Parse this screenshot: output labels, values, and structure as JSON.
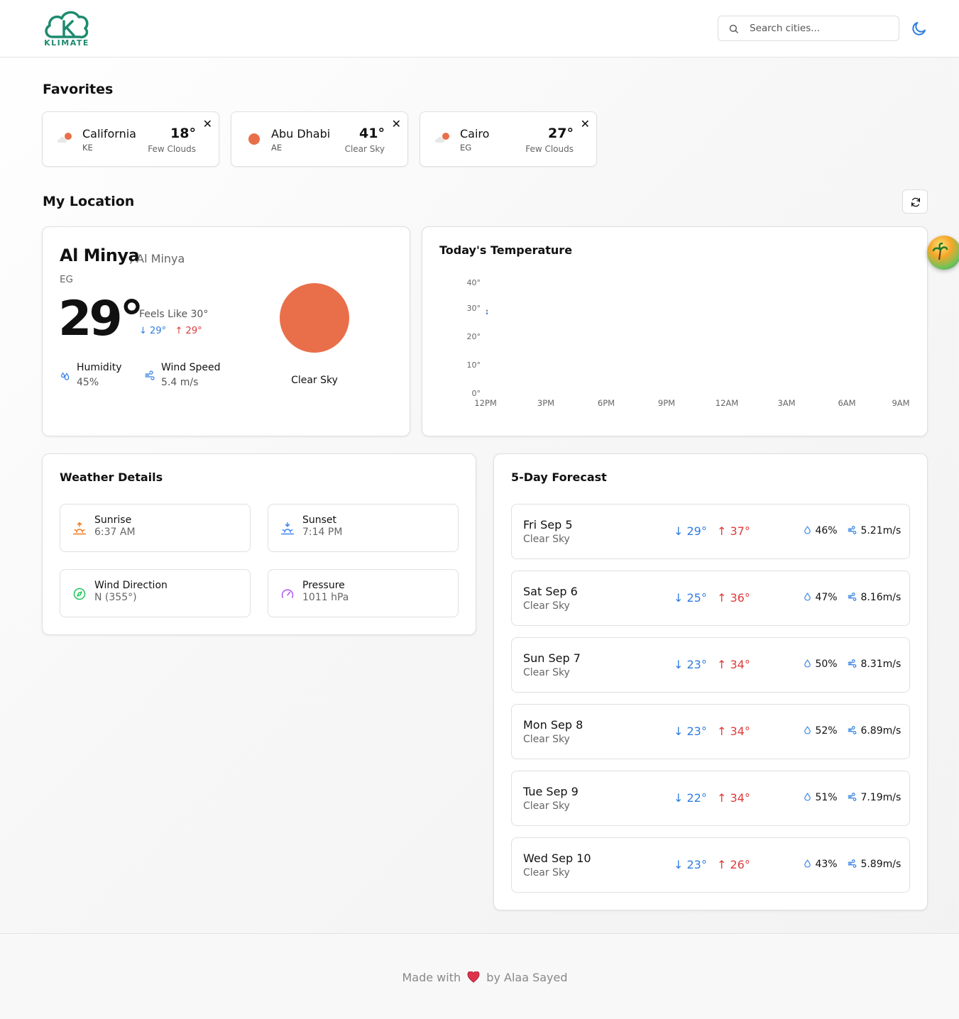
{
  "header": {
    "logo_text": "KLIMATE",
    "search_placeholder": "Search cities...",
    "theme_icon": "moon-icon"
  },
  "favorites": {
    "title": "Favorites",
    "items": [
      {
        "name": "California",
        "country": "KE",
        "temp": "18°",
        "desc": "Few Clouds",
        "icon": "few-clouds-icon"
      },
      {
        "name": "Abu Dhabi",
        "country": "AE",
        "temp": "41°",
        "desc": "Clear Sky",
        "icon": "clear-sky-icon"
      },
      {
        "name": "Cairo",
        "country": "EG",
        "temp": "27°",
        "desc": "Few Clouds",
        "icon": "few-clouds-icon"
      }
    ]
  },
  "location": {
    "title": "My Location",
    "city": "Al Minya",
    "region": ", Al Minya",
    "country": "EG",
    "temp": "29°",
    "feels_like": "Feels Like 30°",
    "min": "29°",
    "max": "29°",
    "humidity_label": "Humidity",
    "humidity": "45%",
    "wind_label": "Wind Speed",
    "wind": "5.4 m/s",
    "condition": "Clear Sky",
    "sun_color": "#e96f4a"
  },
  "chart_data": {
    "type": "line",
    "title": "Today's Temperature",
    "x": [
      "12PM",
      "3PM",
      "6PM",
      "9PM",
      "12AM",
      "3AM",
      "6AM",
      "9AM"
    ],
    "y_ticks": [
      "40°",
      "30°",
      "20°",
      "10°",
      "0°"
    ],
    "ylim": [
      0,
      40
    ],
    "series": [
      {
        "values": [
          29,
          null,
          null,
          null,
          null,
          null,
          null,
          null
        ],
        "color": "#2f7de1"
      },
      {
        "values": [
          30,
          null,
          null,
          null,
          null,
          null,
          null,
          null
        ],
        "color": "#888888"
      }
    ]
  },
  "details": {
    "title": "Weather Details",
    "items": [
      {
        "label": "Sunrise",
        "value": "6:37 AM",
        "icon": "sunrise-icon",
        "color": "#f97316"
      },
      {
        "label": "Sunset",
        "value": "7:14 PM",
        "icon": "sunset-icon",
        "color": "#3b82f6"
      },
      {
        "label": "Wind Direction",
        "value": "N (355°)",
        "icon": "compass-icon",
        "color": "#22c55e"
      },
      {
        "label": "Pressure",
        "value": "1011 hPa",
        "icon": "gauge-icon",
        "color": "#a855f7"
      }
    ]
  },
  "forecast": {
    "title": "5-Day Forecast",
    "days": [
      {
        "day": "Fri Sep 5",
        "desc": "Clear Sky",
        "min": "29°",
        "max": "37°",
        "humidity": "46%",
        "wind": "5.21m/s"
      },
      {
        "day": "Sat Sep 6",
        "desc": "Clear Sky",
        "min": "25°",
        "max": "36°",
        "humidity": "47%",
        "wind": "8.16m/s"
      },
      {
        "day": "Sun Sep 7",
        "desc": "Clear Sky",
        "min": "23°",
        "max": "34°",
        "humidity": "50%",
        "wind": "8.31m/s"
      },
      {
        "day": "Mon Sep 8",
        "desc": "Clear Sky",
        "min": "23°",
        "max": "34°",
        "humidity": "52%",
        "wind": "6.89m/s"
      },
      {
        "day": "Tue Sep 9",
        "desc": "Clear Sky",
        "min": "22°",
        "max": "34°",
        "humidity": "51%",
        "wind": "7.19m/s"
      },
      {
        "day": "Wed Sep 10",
        "desc": "Clear Sky",
        "min": "23°",
        "max": "26°",
        "humidity": "43%",
        "wind": "5.89m/s"
      }
    ]
  },
  "footer": {
    "before": "Made with",
    "after": "by Alaa Sayed",
    "heart_icon": "heart-icon"
  }
}
